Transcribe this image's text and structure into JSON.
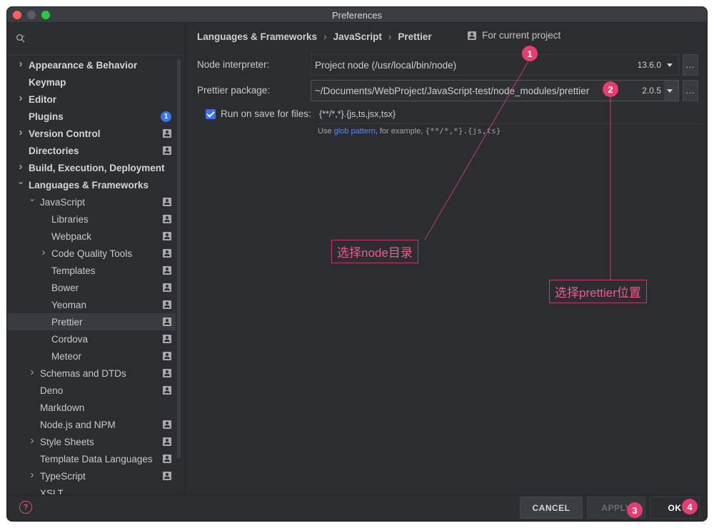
{
  "window": {
    "title": "Preferences"
  },
  "sidebar": {
    "items": [
      {
        "label": "Appearance & Behavior",
        "bold": true,
        "chevron": "right",
        "level": 0
      },
      {
        "label": "Keymap",
        "bold": true,
        "level": 0
      },
      {
        "label": "Editor",
        "bold": true,
        "chevron": "right",
        "level": 0
      },
      {
        "label": "Plugins",
        "bold": true,
        "level": 0,
        "badge": "1"
      },
      {
        "label": "Version Control",
        "bold": true,
        "chevron": "right",
        "level": 0,
        "project": true
      },
      {
        "label": "Directories",
        "bold": true,
        "level": 0,
        "project": true
      },
      {
        "label": "Build, Execution, Deployment",
        "bold": true,
        "chevron": "right",
        "level": 0
      },
      {
        "label": "Languages & Frameworks",
        "bold": true,
        "chevron": "down",
        "level": 0
      },
      {
        "label": "JavaScript",
        "chevron": "down",
        "level": 1,
        "project": true
      },
      {
        "label": "Libraries",
        "level": 2,
        "project": true
      },
      {
        "label": "Webpack",
        "level": 2,
        "project": true
      },
      {
        "label": "Code Quality Tools",
        "chevron": "right",
        "level": 2,
        "project": true
      },
      {
        "label": "Templates",
        "level": 2,
        "project": true
      },
      {
        "label": "Bower",
        "level": 2,
        "project": true
      },
      {
        "label": "Yeoman",
        "level": 2,
        "project": true
      },
      {
        "label": "Prettier",
        "level": 2,
        "project": true,
        "selected": true
      },
      {
        "label": "Cordova",
        "level": 2,
        "project": true
      },
      {
        "label": "Meteor",
        "level": 2,
        "project": true
      },
      {
        "label": "Schemas and DTDs",
        "chevron": "right",
        "level": 1,
        "project": true
      },
      {
        "label": "Deno",
        "level": 1,
        "project": true
      },
      {
        "label": "Markdown",
        "level": 1
      },
      {
        "label": "Node.js and NPM",
        "level": 1,
        "project": true
      },
      {
        "label": "Style Sheets",
        "chevron": "right",
        "level": 1,
        "project": true
      },
      {
        "label": "Template Data Languages",
        "level": 1,
        "project": true
      },
      {
        "label": "TypeScript",
        "chevron": "right",
        "level": 1,
        "project": true
      },
      {
        "label": "XSLT",
        "level": 1
      }
    ]
  },
  "breadcrumb": {
    "items": [
      "Languages & Frameworks",
      "JavaScript",
      "Prettier"
    ],
    "separator": "›",
    "project_note": "For current project"
  },
  "form": {
    "node_label": "Node interpreter:",
    "node_value": "Project  node (/usr/local/bin/node)",
    "node_version": "13.6.0",
    "package_label": "Prettier package:",
    "package_value": "~/Documents/WebProject/JavaScript-test/node_modules/prettier",
    "package_version": "2.0.5",
    "browse_label": "...",
    "run_on_save_label": "Run on save for files:",
    "run_on_save_checked": true,
    "run_on_save_pattern": "{**/*,*}.{js,ts,jsx,tsx}",
    "hint_prefix": "Use ",
    "hint_link": "glob pattern",
    "hint_middle": ", for example, ",
    "hint_example": "{**/*,*}.{js,ts}"
  },
  "footer": {
    "help_icon": "?",
    "cancel": "CANCEL",
    "apply": "APPLY",
    "ok": "OK"
  },
  "annotations": {
    "marker1": "1",
    "marker2": "2",
    "marker3": "3",
    "marker4": "4",
    "note1": "选择node目录",
    "note2": "选择prettier位置",
    "color": "#e53d6f"
  },
  "colors": {
    "window_bg": "#2b2d30",
    "accent": "#3574f0",
    "link": "#548af7"
  }
}
